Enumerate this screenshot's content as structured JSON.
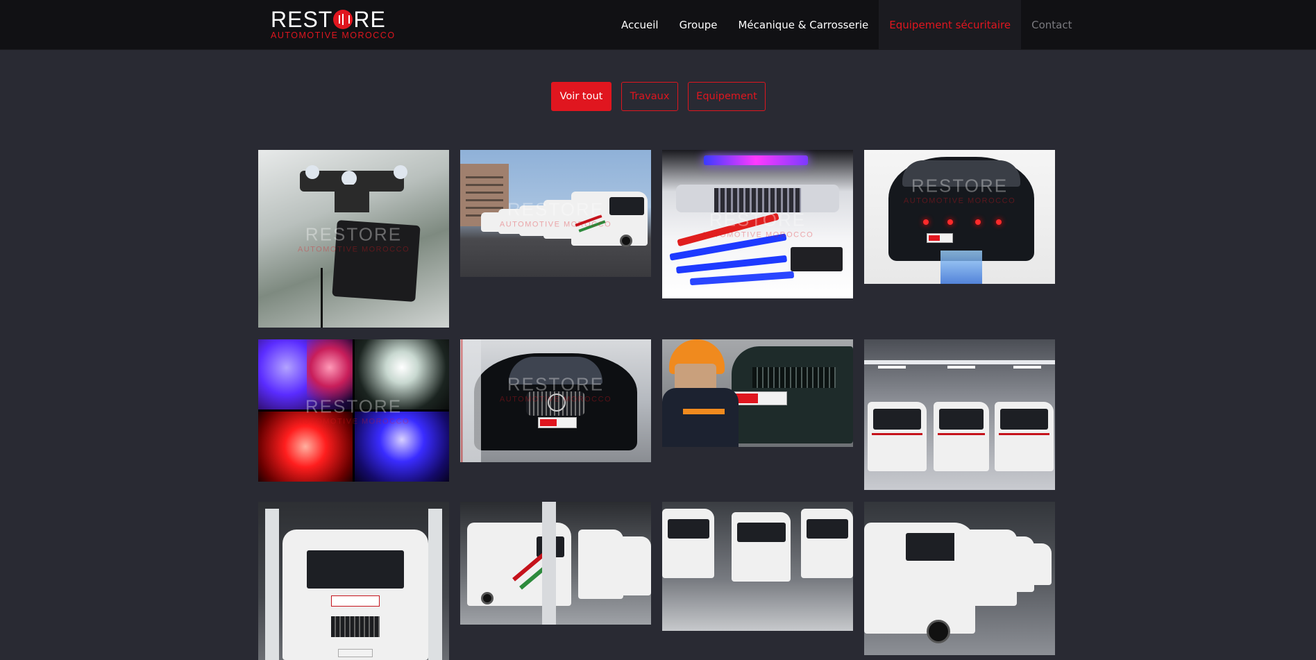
{
  "brand": {
    "name_left": "REST",
    "name_right": "RE",
    "tagline": "AUTOMOTIVE MOROCCO"
  },
  "nav": {
    "items": [
      {
        "label": "Accueil"
      },
      {
        "label": "Groupe"
      },
      {
        "label": "Mécanique & Carrosserie"
      },
      {
        "label": "Equipement sécuritaire",
        "state": "active"
      },
      {
        "label": "Contact",
        "state": "muted"
      }
    ]
  },
  "filters": {
    "all": "Voir tout",
    "works": "Travaux",
    "equipment": "Equipement",
    "selected": "Voir tout"
  },
  "gallery": {
    "watermark": "RESTORE",
    "watermark_sub": "AUTOMOTIVE MOROCCO",
    "items": [
      {
        "subject": "windshield-mounted-light-bracket"
      },
      {
        "subject": "row-of-service-vans"
      },
      {
        "subject": "police-lightbar-kit"
      },
      {
        "subject": "dark-sedan-with-grille-lights"
      },
      {
        "subject": "led-strobe-colors"
      },
      {
        "subject": "black-mercedes-front"
      },
      {
        "subject": "technician-installing-lights"
      },
      {
        "subject": "three-white-vans-in-hangar"
      },
      {
        "subject": "police-van-front"
      },
      {
        "subject": "national-security-vans"
      },
      {
        "subject": "police-vans-parked"
      },
      {
        "subject": "line-of-police-vans"
      }
    ]
  },
  "colors": {
    "accent": "#e0161f",
    "background": "#292a33",
    "header": "#111114"
  }
}
